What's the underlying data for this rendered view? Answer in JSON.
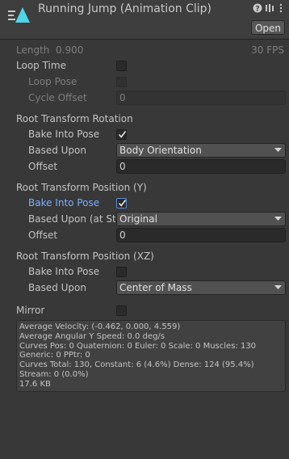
{
  "header": {
    "title": "Running Jump (Animation Clip)",
    "open_label": "Open",
    "help_icon": "help-icon",
    "preset_icon": "preset-icon",
    "menu_icon": "kebab-menu-icon"
  },
  "clip": {
    "length_label": "Length",
    "length_value": "0.900",
    "fps": "30 FPS"
  },
  "loop": {
    "loop_time_label": "Loop Time",
    "loop_time_checked": false,
    "loop_pose_label": "Loop Pose",
    "cycle_offset_label": "Cycle Offset",
    "cycle_offset_value": "0"
  },
  "root_rotation": {
    "title": "Root Transform Rotation",
    "bake_label": "Bake Into Pose",
    "bake_checked": true,
    "based_upon_label": "Based Upon",
    "based_upon_value": "Body Orientation",
    "offset_label": "Offset",
    "offset_value": "0"
  },
  "root_position_y": {
    "title": "Root Transform Position (Y)",
    "bake_label": "Bake Into Pose",
    "bake_checked": true,
    "based_upon_label": "Based Upon (at Sta",
    "based_upon_value": "Original",
    "offset_label": "Offset",
    "offset_value": "0"
  },
  "root_position_xz": {
    "title": "Root Transform Position (XZ)",
    "bake_label": "Bake Into Pose",
    "bake_checked": false,
    "based_upon_label": "Based Upon",
    "based_upon_value": "Center of Mass"
  },
  "mirror": {
    "label": "Mirror",
    "checked": false
  },
  "info": {
    "lines": [
      "Average Velocity: (-0.462, 0.000, 4.559)",
      "Average Angular Y Speed: 0.0 deg/s",
      "Curves Pos: 0 Quaternion: 0 Euler: 0 Scale: 0 Muscles: 130 Generic: 0 PPtr: 0",
      "Curves Total: 130, Constant: 6 (4.6%) Dense: 124 (95.4%) Stream: 0 (0.0%)",
      "17.6 KB"
    ]
  },
  "colors": {
    "background": "#383838",
    "accent_label": "#7ab0ff",
    "icon_cyan": "#4fd6e6"
  }
}
